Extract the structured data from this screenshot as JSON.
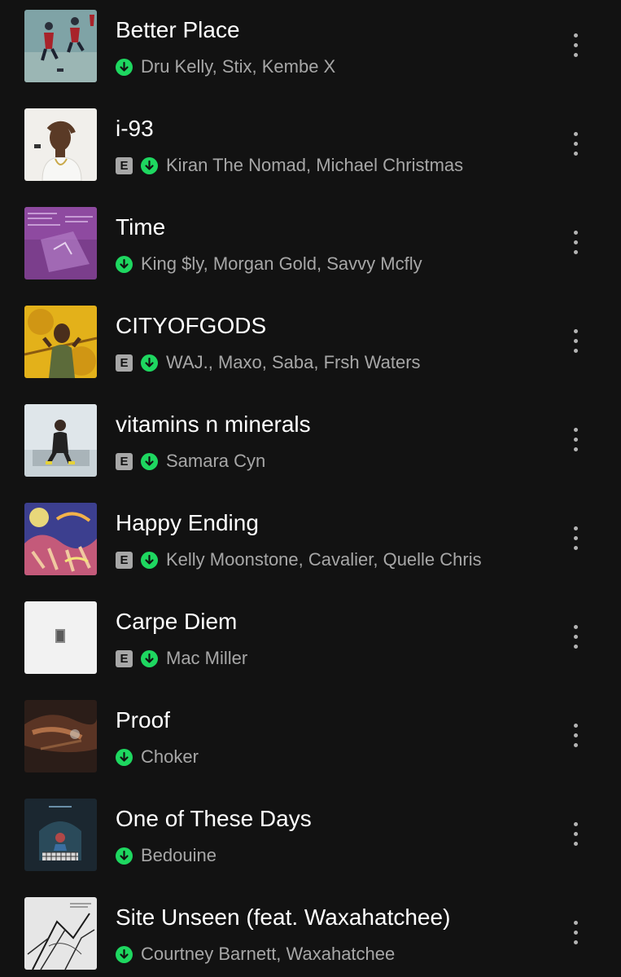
{
  "colors": {
    "background": "#121212",
    "title": "#ffffff",
    "subtitle": "#a7a7a7",
    "download_green": "#1ed760",
    "explicit_badge": "#a7a7a7"
  },
  "explicit_label": "E",
  "icons": {
    "downloaded": "downloaded-arrow-icon",
    "more": "more-options-icon",
    "explicit": "explicit-badge"
  },
  "tracks": [
    {
      "title": "Better Place",
      "artists": "Dru Kelly, Stix, Kembe X",
      "explicit": false
    },
    {
      "title": "i-93",
      "artists": "Kiran The Nomad, Michael Christmas",
      "explicit": true
    },
    {
      "title": "Time",
      "artists": "King $ly, Morgan Gold, Savvy Mcfly",
      "explicit": false
    },
    {
      "title": "CITYOFGODS",
      "artists": "WAJ., Maxo, Saba, Frsh Waters",
      "explicit": true
    },
    {
      "title": "vitamins n minerals",
      "artists": "Samara Cyn",
      "explicit": true
    },
    {
      "title": "Happy Ending",
      "artists": "Kelly Moonstone, Cavalier, Quelle Chris",
      "explicit": true
    },
    {
      "title": "Carpe Diem",
      "artists": "Mac Miller",
      "explicit": true
    },
    {
      "title": "Proof",
      "artists": "Choker",
      "explicit": false
    },
    {
      "title": "One of These Days",
      "artists": "Bedouine",
      "explicit": false
    },
    {
      "title": "Site Unseen (feat. Waxahatchee)",
      "artists": "Courtney Barnett, Waxahatchee",
      "explicit": false
    }
  ]
}
